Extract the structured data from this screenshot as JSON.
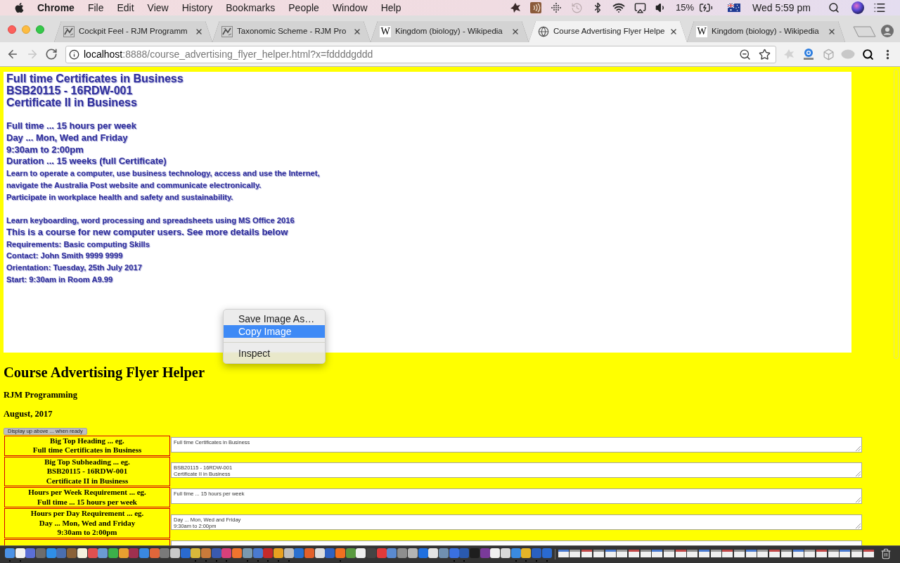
{
  "menu_bar": {
    "app": "Chrome",
    "menus": [
      "File",
      "Edit",
      "View",
      "History",
      "Bookmarks",
      "People",
      "Window",
      "Help"
    ],
    "battery": "15%",
    "clock": "Wed 5:59 pm"
  },
  "tabs": [
    {
      "title": "Cockpit Feel - RJM Programm",
      "kind": "thumbnail",
      "selected": false
    },
    {
      "title": "Taxonomic Scheme - RJM Pro",
      "kind": "thumbnail",
      "selected": false
    },
    {
      "title": "Kingdom (biology) - Wikipedia",
      "kind": "letter",
      "favicon_text": "W",
      "selected": false
    },
    {
      "title": "Course Advertising Flyer Helpe",
      "kind": "globe",
      "selected": true
    },
    {
      "title": "Kingdom (biology) - Wikipedia",
      "kind": "letter",
      "favicon_text": "W",
      "selected": false
    }
  ],
  "toolbar": {
    "nav_buttons": [
      {
        "kind": "back",
        "disabled": false
      },
      {
        "kind": "forward",
        "disabled": true
      },
      {
        "kind": "reload",
        "disabled": false
      }
    ],
    "url": {
      "host": "localhost",
      "path": ":8888/course_advertising_flyer_helper.html?x=fddddgddd"
    }
  },
  "flyer": {
    "blocks": [
      [
        {
          "kind": "large",
          "text": "Full time Certificates in Business"
        },
        {
          "kind": "large",
          "text": "BSB20115 - 16RDW-001"
        },
        {
          "kind": "large",
          "text": "Certificate II in Business"
        }
      ],
      [
        {
          "kind": "medium",
          "text": "Full time ... 15 hours per week"
        },
        {
          "kind": "medium",
          "text": "Day ... Mon, Wed and Friday"
        },
        {
          "kind": "medium",
          "text": "9:30am to 2:00pm"
        },
        {
          "kind": "medium",
          "text": "Duration ... 15 weeks (full Certificate)"
        },
        {
          "kind": "small",
          "text": "Learn to operate a computer, use business technology, access and use the Internet,"
        },
        {
          "kind": "small",
          "text": "navigate the Australia Post website and communicate electronically."
        },
        {
          "kind": "small",
          "text": "Participate in workplace health and safety and sustainability."
        }
      ],
      [
        {
          "kind": "small",
          "text": "Learn keyboarding, word processing and spreadsheets using MS Office 2016"
        },
        {
          "kind": "medium",
          "text": "This is a course for new computer users. See more details below"
        },
        {
          "kind": "small",
          "text": "Requirements: Basic computing Skills"
        },
        {
          "kind": "small",
          "text": "Contact: John Smith 9999 9999"
        },
        {
          "kind": "small",
          "text": "Orientation: Tuesday, 25th July 2017"
        },
        {
          "kind": "small",
          "text": "Start: 9:30am in Room A9.99"
        }
      ]
    ]
  },
  "context_menu": {
    "groups": [
      [
        {
          "label": "Save Image As…",
          "selected": false
        },
        {
          "label": "Copy Image",
          "selected": true
        }
      ],
      [
        {
          "label": "Inspect",
          "selected": false
        }
      ]
    ]
  },
  "page": {
    "title": "Course Advertising Flyer Helper",
    "author": "RJM Programming",
    "date": "August, 2017",
    "display_button": "Display up above ... when ready",
    "fields": [
      {
        "label_lines": [
          "Big Top Heading ... eg.",
          "Full time Certificates in Business"
        ],
        "value": "Full time Certificates in Business"
      },
      {
        "label_lines": [
          "Big Top Subheading ... eg.",
          "BSB20115 - 16RDW-001",
          "Certificate II in Business"
        ],
        "value": "BSB20115 - 16RDW-001\nCertificate II in Business"
      },
      {
        "label_lines": [
          "Hours per Week Requirement ... eg.",
          "Full time ... 15 hours per week"
        ],
        "value": "Full time ... 15 hours per week"
      },
      {
        "label_lines": [
          "Hours per Day Requirement ... eg.",
          "Day ... Mon, Wed and Friday",
          "9:30am to 2:00pm"
        ],
        "value": "Day ... Mon, Wed and Friday\n9:30am to 2:00pm"
      }
    ]
  },
  "dock": {
    "apps": [
      {
        "running": true
      },
      {
        "running": true
      },
      {
        "running": false
      },
      {
        "running": false
      },
      {
        "running": false
      },
      {
        "running": false
      },
      {
        "running": false
      },
      {
        "running": false
      },
      {
        "running": false
      },
      {
        "running": false
      },
      {
        "running": false
      },
      {
        "running": false
      },
      {
        "running": false
      },
      {
        "running": false
      },
      {
        "running": false
      },
      {
        "running": false
      },
      {
        "running": false
      },
      {
        "running": false
      },
      {
        "running": true
      },
      {
        "running": true
      },
      {
        "running": true
      },
      {
        "running": true
      },
      {
        "running": false
      },
      {
        "running": true
      },
      {
        "running": true
      },
      {
        "running": true
      },
      {
        "running": true
      },
      {
        "running": true
      },
      {
        "running": false
      },
      {
        "running": false
      },
      {
        "running": false
      },
      {
        "running": false
      },
      {
        "running": true
      },
      {
        "running": false
      },
      {
        "running": false
      },
      {
        "running": false
      },
      {
        "running": false
      },
      {
        "running": false
      },
      {
        "running": false
      },
      {
        "running": false
      },
      {
        "running": false
      },
      {
        "running": false
      },
      {
        "running": false
      },
      {
        "running": true
      },
      {
        "running": true
      },
      {
        "running": false
      },
      {
        "running": false
      },
      {
        "running": false
      },
      {
        "running": false
      },
      {
        "running": true
      },
      {
        "running": true
      },
      {
        "running": true
      },
      {
        "running": true
      }
    ]
  }
}
